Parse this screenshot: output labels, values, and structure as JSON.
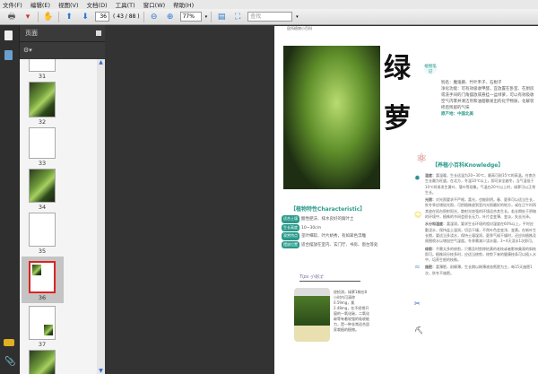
{
  "menu": [
    "文件(F)",
    "编辑(E)",
    "视图(V)",
    "文档(D)",
    "工具(T)",
    "窗口(W)",
    "帮助(H)"
  ],
  "toolbar": {
    "page_current": "36",
    "page_info": "( 43 / 88 )",
    "zoom": "77%",
    "search_placeholder": "查找"
  },
  "panel": {
    "title": "页面"
  },
  "thumbnails": [
    {
      "label": "31"
    },
    {
      "label": "32"
    },
    {
      "label": "33"
    },
    {
      "label": "34"
    },
    {
      "label": "35"
    },
    {
      "label": "36",
      "selected": true
    },
    {
      "label": "37"
    }
  ],
  "doc": {
    "header": "居所植物小百科",
    "title_char1": "绿",
    "title_char2": "萝",
    "badge": "植物笔记",
    "alias": "别名：魔鬼藤、竹叶禾子、石柑子",
    "purify": "净化功能：可有效吸收甲醛，宜放置在卧室、在厨房或洗手间的门角摆放或悬挂一盆绿萝，可以有效吸收空气内苯并清洁剂和油烟散发出的化学物质，化解装修后残留的气味",
    "origin": "原产地：中国北美",
    "char_title": "【植物特性Characteristic】",
    "char_rows": [
      {
        "tag": "适合土壤",
        "text": "酸性肥沃、排水良好的腐叶土"
      },
      {
        "tag": "生长高度",
        "text": "10~30cm"
      },
      {
        "tag": "观赏特点",
        "text": "茎叶细软、叶片娇秀，有如翠色浮雕"
      },
      {
        "tag": "摆放位置",
        "text": "适合摆放在室内、玄门厅、书房、窗台等处"
      }
    ],
    "tips_title": "Tips 小贴士",
    "tips_text": "经检测，绿萝1株在8小时内可清除0.59mg，氯2.48mg，在不经常开窗的一氧化碳，二氧化碳等有着较强的吸收能力，是一种非常适合居家栽植的植物。",
    "knowledge_title": "【养植小百科Knowledge】",
    "knowledge": [
      {
        "head": "温度：",
        "text": "喜温暖，生长适温为20~30℃，最高可耐35℃的高温。在南方生长最为旺盛，在北方，冬温10℃以上，即可安全越冬，当气温低于10℃时易发生黄叶、落叶等现象。气温在20℃以上时，绿萝可以正常生长。"
      },
      {
        "head": "光照：",
        "text": "对光照要求不严格，喜光，也能耐阴。春、夏季可以适当生长，秋冬季应增加光照，可把植株放到室内光照最好的地方，或在正午时再其放在阳台照射阳光，散射光较强的环境适合其生长。若长期处于阴暗的环境中，植株的节间会很长无力，叶片会变薄、变淡，失去光泽。"
      },
      {
        "head": "水分和湿度：",
        "text": "喜湿润，要求生长环境的相对湿度在60%以上，平时应勤浇水，保持盆土湿润，切忌干燥，不然叶色会变浅、变黄。在新叶生长期，要适当多浇水，保持土壤湿润，夏季气候干燥时，还应向植株及周围喷水以增加空气湿度。冬季需减少浇水量，3~4天浇水1次即可。"
      },
      {
        "head": "修剪：",
        "text": "不需太多的修剪，只需及时剪除枯黄的老枝或者影响美观的斜枝即可。植株间分枝多时，应适当修剪，修剪下来的健康枝条可以插入水中，培养生根的枝株。"
      },
      {
        "head": "施肥：",
        "text": "喜薄肥，耐瘠薄，生长期以稀薄液态氮肥为主，每15天施肥1次，秋冬不施肥。"
      }
    ]
  },
  "colors": {
    "accent": "#2a9a8a",
    "page_bg": "#333333"
  }
}
